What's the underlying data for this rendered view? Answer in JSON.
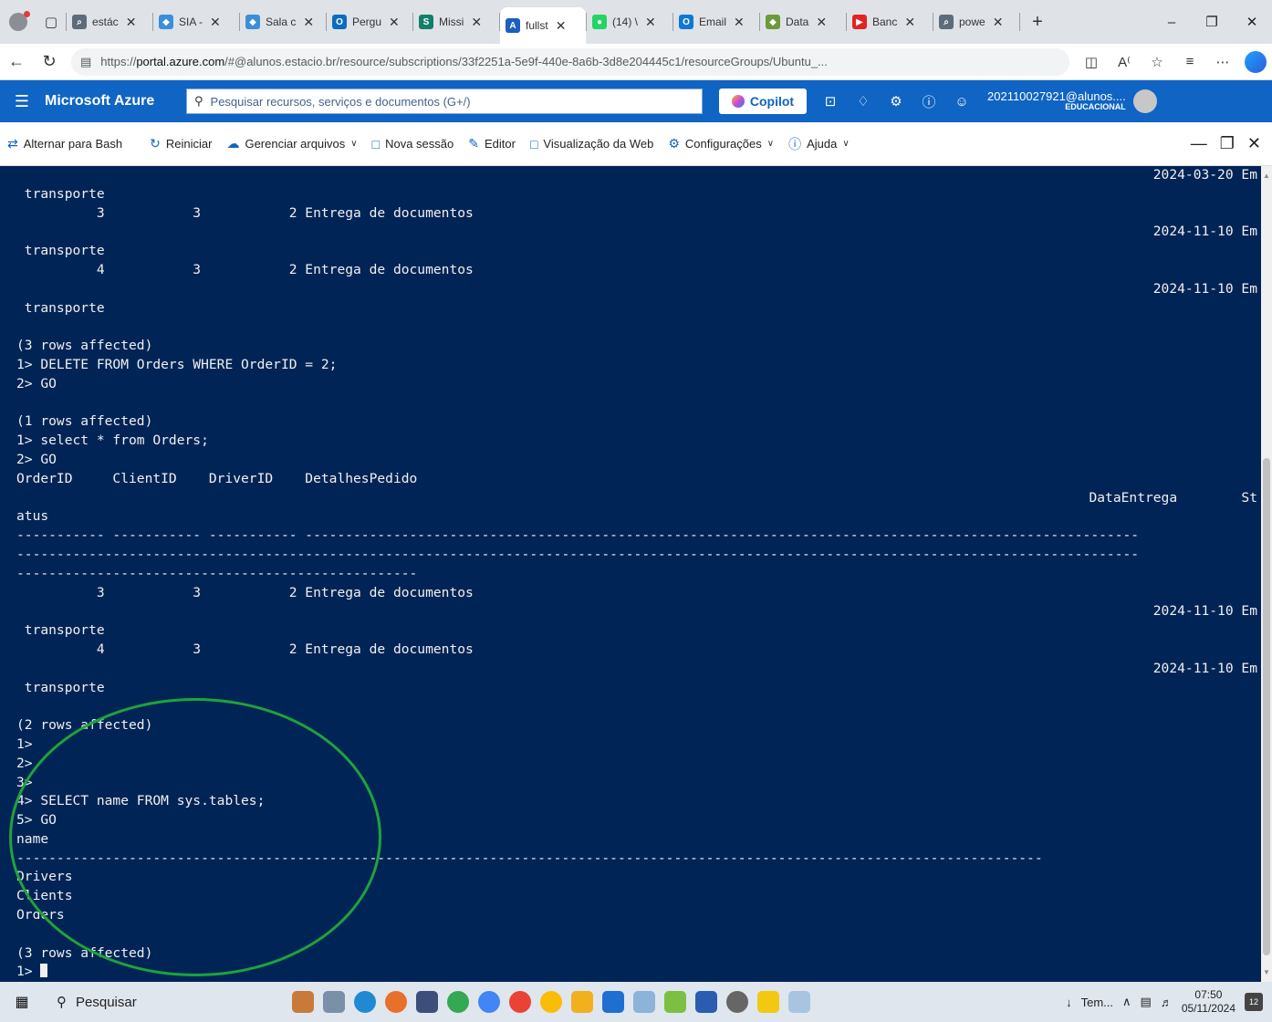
{
  "browser": {
    "tabs": [
      {
        "label": "estác",
        "color": "#5e6b7a",
        "glyph": "⌕"
      },
      {
        "label": "SIA -",
        "color": "#3b8fd8",
        "glyph": "◆"
      },
      {
        "label": "Sala c",
        "color": "#3b8fd8",
        "glyph": "◆"
      },
      {
        "label": "Pergu",
        "color": "#0f6cbd",
        "glyph": "O"
      },
      {
        "label": "Missi",
        "color": "#137f6a",
        "glyph": "S"
      },
      {
        "label": "fullst",
        "color": "#1a5fc1",
        "glyph": "A",
        "active": true
      },
      {
        "label": "(14) \\",
        "color": "#25d366",
        "glyph": "●"
      },
      {
        "label": "Email",
        "color": "#0f78d4",
        "glyph": "O"
      },
      {
        "label": "Data",
        "color": "#6c9a3a",
        "glyph": "◆"
      },
      {
        "label": "Banc",
        "color": "#e02424",
        "glyph": "▶"
      },
      {
        "label": "powe",
        "color": "#5e6b7a",
        "glyph": "⌕"
      }
    ],
    "url_prefix": "https://",
    "url_host": "portal.azure.com",
    "url_rest": "/#@alunos.estacio.br/resource/subscriptions/33f2251a-5e9f-440e-8a6b-3d8e204445c1/resourceGroups/Ubuntu_..."
  },
  "azure": {
    "brand": "Microsoft Azure",
    "search_placeholder": "Pesquisar recursos, serviços e documentos (G+/)",
    "copilot": "Copilot",
    "account_user": "202110027921@alunos....",
    "account_tenant": "EDUCACIONAL"
  },
  "shell_toolbar": {
    "switch_bash": "Alternar para Bash",
    "restart": "Reiniciar",
    "manage_files": "Gerenciar arquivos",
    "new_session": "Nova sessão",
    "editor": "Editor",
    "web_preview": "Visualização da Web",
    "settings": "Configurações",
    "help": "Ajuda"
  },
  "terminal": {
    "lines": [
      {
        "t": "2024-03-20 Em",
        "r": true
      },
      {
        "t": " transporte"
      },
      {
        "t": "          3           3           2 Entrega de documentos"
      },
      {
        "t": "2024-11-10 Em",
        "r": true
      },
      {
        "t": " transporte"
      },
      {
        "t": "          4           3           2 Entrega de documentos"
      },
      {
        "t": "2024-11-10 Em",
        "r": true
      },
      {
        "t": " transporte"
      },
      {
        "t": ""
      },
      {
        "t": "(3 rows affected)"
      },
      {
        "t": "1> DELETE FROM Orders WHERE OrderID = 2;"
      },
      {
        "t": "2> GO"
      },
      {
        "t": ""
      },
      {
        "t": "(1 rows affected)"
      },
      {
        "t": "1> select * from Orders;"
      },
      {
        "t": "2> GO"
      },
      {
        "t": "OrderID     ClientID    DriverID    DetalhesPedido"
      },
      {
        "t": "DataEntrega        St",
        "r": true
      },
      {
        "t": "atus"
      },
      {
        "t": "----------- ----------- ----------- --------------------------------------------------------------------------------------------------------"
      },
      {
        "t": "--------------------------------------------------------------------------------------------------------------------------------------------"
      },
      {
        "t": "--------------------------------------------------"
      },
      {
        "t": "          3           3           2 Entrega de documentos"
      },
      {
        "t": "2024-11-10 Em",
        "r": true
      },
      {
        "t": " transporte"
      },
      {
        "t": "          4           3           2 Entrega de documentos"
      },
      {
        "t": "2024-11-10 Em",
        "r": true
      },
      {
        "t": " transporte"
      },
      {
        "t": ""
      },
      {
        "t": "(2 rows affected)"
      },
      {
        "t": "1>"
      },
      {
        "t": "2>"
      },
      {
        "t": "3>"
      },
      {
        "t": "4> SELECT name FROM sys.tables;"
      },
      {
        "t": "5> GO"
      },
      {
        "t": "name"
      },
      {
        "t": "--------------------------------------------------------------------------------------------------------------------------------"
      },
      {
        "t": "Drivers"
      },
      {
        "t": "Clients"
      },
      {
        "t": "Orders"
      },
      {
        "t": ""
      },
      {
        "t": "(3 rows affected)"
      },
      {
        "t": "1> ",
        "cursor": true
      }
    ]
  },
  "taskbar": {
    "search": "Pesquisar",
    "weather": "Tem...",
    "time": "07:50",
    "date": "05/11/2024",
    "notifications": "12"
  },
  "colors": {
    "terminal_bg": "#012456",
    "azure_header": "#0f64c4",
    "annotation": "#1ea33a"
  }
}
